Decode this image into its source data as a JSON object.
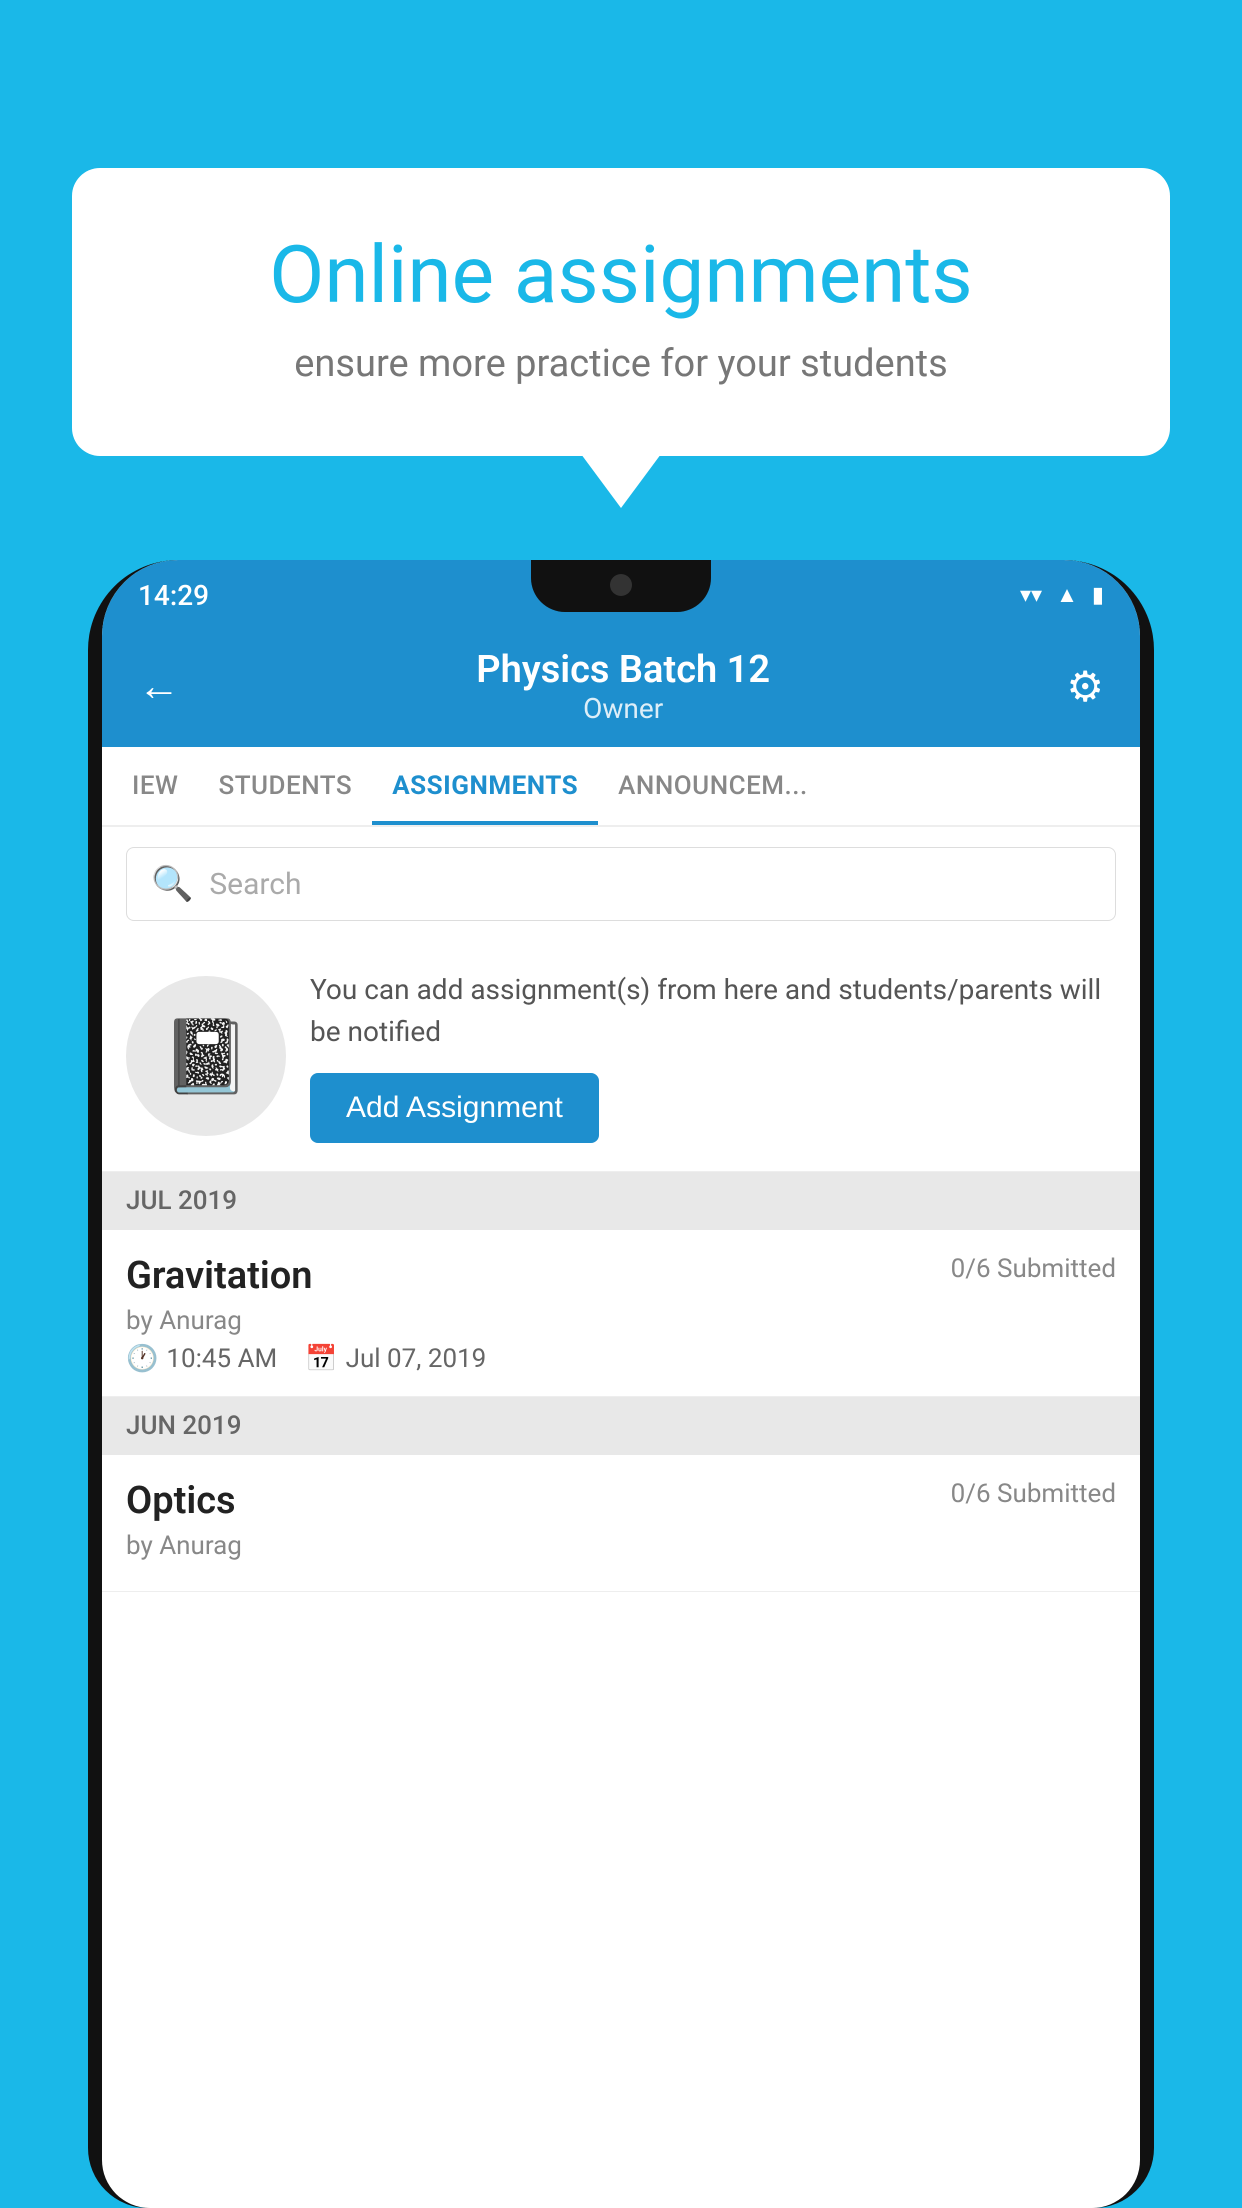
{
  "background_color": "#1ab8e8",
  "speech_bubble": {
    "title": "Online assignments",
    "subtitle": "ensure more practice for your students"
  },
  "status_bar": {
    "time": "14:29",
    "icons": [
      "wifi",
      "signal",
      "battery"
    ]
  },
  "header": {
    "title": "Physics Batch 12",
    "subtitle": "Owner",
    "back_label": "←",
    "gear_label": "⚙"
  },
  "tabs": [
    {
      "label": "IEW",
      "active": false
    },
    {
      "label": "STUDENTS",
      "active": false
    },
    {
      "label": "ASSIGNMENTS",
      "active": true
    },
    {
      "label": "ANNOUNCEM...",
      "active": false
    }
  ],
  "search": {
    "placeholder": "Search"
  },
  "promo": {
    "icon": "📓",
    "text": "You can add assignment(s) from here and students/parents will be notified",
    "button_label": "Add Assignment"
  },
  "sections": [
    {
      "month": "JUL 2019",
      "assignments": [
        {
          "name": "Gravitation",
          "status": "0/6 Submitted",
          "author": "by Anurag",
          "time": "10:45 AM",
          "date": "Jul 07, 2019"
        }
      ]
    },
    {
      "month": "JUN 2019",
      "assignments": [
        {
          "name": "Optics",
          "status": "0/6 Submitted",
          "author": "by Anurag",
          "time": "",
          "date": ""
        }
      ]
    }
  ]
}
